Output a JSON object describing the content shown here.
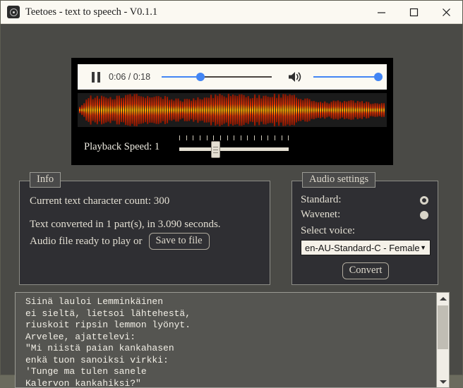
{
  "window": {
    "title": "Teetoes - text to speech - V0.1.1",
    "icon": "app-disc-icon",
    "minimize_label": "—",
    "maximize_label": "□",
    "close_label": "✕"
  },
  "player": {
    "pause_icon": "pause-icon",
    "time_display": "0:06 / 0:18",
    "current_time": "0:06",
    "duration": "0:18",
    "seek_percent": 35,
    "speaker_icon": "speaker-on-icon",
    "volume_percent": 100,
    "accent_color": "#4285f4",
    "speed_label": "Playback Speed: 1",
    "speed_value": "1",
    "speed_percent": 33,
    "speed_tick_count": 17,
    "waveform_color_bright": "#ffb300",
    "waveform_color_dark": "#8c1500"
  },
  "info_panel": {
    "title": "Info",
    "char_count_line": "Current text character count: 300",
    "char_count": "300",
    "converted_line": "Text converted in 1 part(s), in 3.090 seconds.",
    "parts": "1",
    "seconds": "3.090",
    "ready_line": "Audio file ready to play or",
    "save_button": "Save to file"
  },
  "audio_panel": {
    "title": "Audio settings",
    "standard_label": "Standard:",
    "standard_selected": true,
    "wavenet_label": "Wavenet:",
    "wavenet_selected": false,
    "select_voice_label": "Select voice:",
    "selected_voice": "en-AU-Standard-C - Female",
    "caret_icon": "▼",
    "convert_button": "Convert"
  },
  "text_editor": {
    "content": "Siinä lauloi Lemminkäinen\nei sieltä, lietsoi lähtehestä,\nriuskoit ripsin lemmon lyönyt.\nArvelee, ajattelevi:\n\"Mi niistä paian kankahasen\nenkä tuon sanoiksi virkki:\n'Tunge ma tulen sanele\nKalervon kankahiksi?\"",
    "scroll_up_icon": "triangle-up-icon",
    "scroll_down_icon": "triangle-down-icon"
  }
}
